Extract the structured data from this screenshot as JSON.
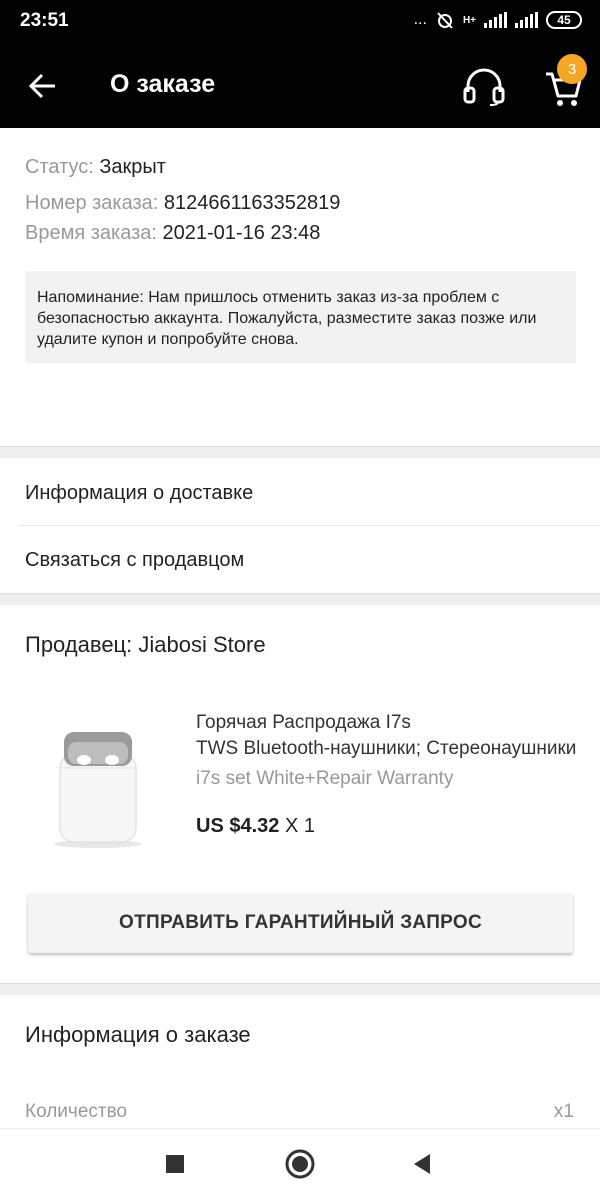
{
  "status_bar": {
    "time": "23:51",
    "dots": "...",
    "network": "H+",
    "battery": "45"
  },
  "app_bar": {
    "title": "О заказе",
    "cart_count": "3",
    "icons": [
      "back-arrow-icon",
      "headset-icon",
      "cart-icon"
    ]
  },
  "order": {
    "status_label": "Статус:",
    "status_value": "Закрыт",
    "number_label": "Номер заказа:",
    "number_value": "8124661163352819",
    "time_label": "Время заказа:",
    "time_value": "2021-01-16 23:48",
    "notice": "Напоминание: Нам пришлось отменить заказ из-за проблем с безопасностью аккаунта. Пожалуйста, разместите заказ позже или удалите купон и попробуйте снова."
  },
  "links": {
    "delivery": "Информация о доставке",
    "contact": "Связаться с продавцом"
  },
  "seller": {
    "label": "Продавец: Jiabosi Store"
  },
  "product": {
    "name_line1": "Горячая Распродажа I7s",
    "name_line2": "TWS Bluetooth-наушники; Стереонаушники",
    "variant": "i7s set White+Repair Warranty",
    "price": "US $4.32",
    "quantity": "X 1"
  },
  "warranty_button": "ОТПРАВИТЬ ГАРАНТИЙНЫЙ ЗАПРОС",
  "order_info": {
    "title": "Информация о заказе",
    "qty_label": "Количество",
    "qty_value": "x1"
  },
  "nav": [
    "recent-apps-icon",
    "home-icon",
    "back-icon"
  ],
  "colors": {
    "header_bg": "#000000",
    "badge": "#f5a623",
    "separator": "#efefef",
    "muted_text": "#999999"
  }
}
